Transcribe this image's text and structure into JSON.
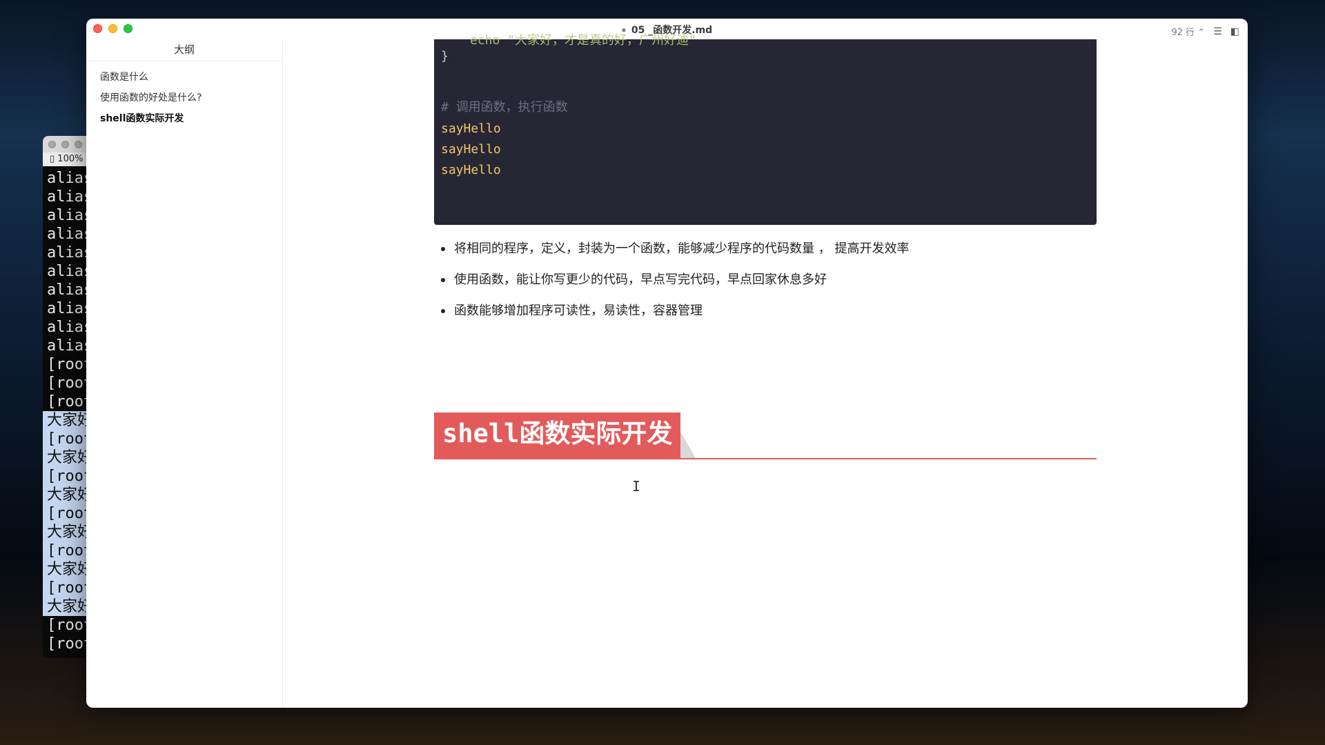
{
  "window": {
    "title": "05 _函数开发.md",
    "line_count": "92 行 ⌃",
    "doc_icon": "document-icon"
  },
  "sidebar": {
    "header": "大纲",
    "items": [
      {
        "label": "函数是什么",
        "active": false
      },
      {
        "label": "使用函数的好处是什么?",
        "active": false
      },
      {
        "label": "shell函数实际开发",
        "active": true
      }
    ]
  },
  "code": {
    "partial_top": "echo \"大家好，才是真的好，广州好迪\"",
    "brace": "}",
    "comment": "# 调用函数，执行函数",
    "calls": [
      "sayHello",
      "sayHello",
      "sayHello"
    ]
  },
  "bullets": [
    "将相同的程序，定义，封装为一个函数，能够减少程序的代码数量 ， 提高开发效率",
    "使用函数，能让你写更少的代码，早点写完代码，早点回家休息多好",
    "函数能够增加程序可读性，易读性，容器管理"
  ],
  "heading": "shell函数实际开发",
  "terminal": {
    "status": "100%",
    "lines": [
      {
        "text": "alias",
        "selected": false
      },
      {
        "text": "alias",
        "selected": false
      },
      {
        "text": "alias",
        "selected": false
      },
      {
        "text": "alias",
        "selected": false
      },
      {
        "text": "alias",
        "selected": false
      },
      {
        "text": "alias",
        "selected": false
      },
      {
        "text": "alias",
        "selected": false
      },
      {
        "text": "alias",
        "selected": false
      },
      {
        "text": "alias",
        "selected": false
      },
      {
        "text": "alias",
        "selected": false
      },
      {
        "text": "[root",
        "selected": false
      },
      {
        "text": "[root",
        "selected": false
      },
      {
        "text": "[root",
        "selected": false
      },
      {
        "text": "大家好",
        "selected": true
      },
      {
        "text": "[root",
        "selected": true
      },
      {
        "text": "大家好",
        "selected": true
      },
      {
        "text": "[root",
        "selected": true
      },
      {
        "text": "大家好",
        "selected": true
      },
      {
        "text": "[root",
        "selected": true
      },
      {
        "text": "大家好",
        "selected": true
      },
      {
        "text": "[root",
        "selected": true
      },
      {
        "text": "大家好",
        "selected": true
      },
      {
        "text": "[root",
        "selected": true
      },
      {
        "text": "大家好",
        "selected": true
      },
      {
        "text": "[root",
        "selected": false
      },
      {
        "text": "[root",
        "selected": false
      }
    ]
  },
  "colors": {
    "heading_bg": "#e35a5a",
    "code_bg": "#272634",
    "code_call": "#f2c66d",
    "code_comment": "#6c6f86"
  }
}
